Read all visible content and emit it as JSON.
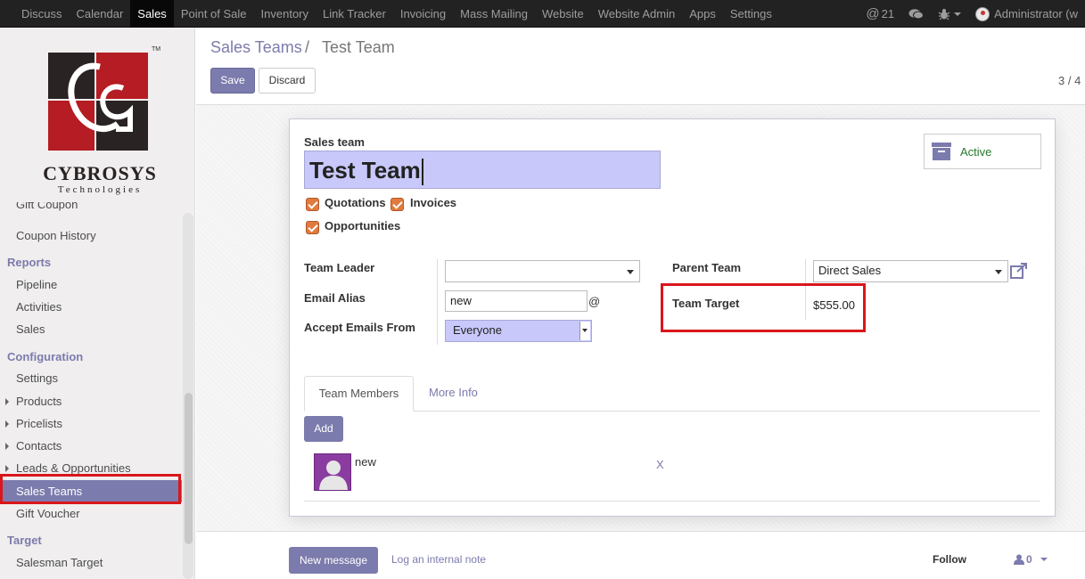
{
  "topbar": {
    "menu": [
      "Discuss",
      "Calendar",
      "Sales",
      "Point of Sale",
      "Inventory",
      "Link Tracker",
      "Invoicing",
      "Mass Mailing",
      "Website",
      "Website Admin",
      "Apps",
      "Settings"
    ],
    "active_menu": "Sales",
    "mentions_count": "21",
    "user_name": "Administrator (w"
  },
  "sidebar": {
    "logo": {
      "brand": "CYBROSYS",
      "tagline": "Technologies",
      "tm": "TM"
    },
    "items": {
      "gift_coupon": "Gift Coupon",
      "coupon_history": "Coupon History",
      "reports": "Reports",
      "pipeline": "Pipeline",
      "activities": "Activities",
      "sales": "Sales",
      "configuration": "Configuration",
      "settings": "Settings",
      "products": "Products",
      "pricelists": "Pricelists",
      "contacts": "Contacts",
      "leads": "Leads & Opportunities",
      "sales_teams": "Sales Teams",
      "gift_voucher": "Gift Voucher",
      "target": "Target",
      "salesman_target": "Salesman Target"
    }
  },
  "control": {
    "breadcrumb_root": "Sales Teams",
    "breadcrumb_sep": "/",
    "breadcrumb_current": "Test Team",
    "save_label": "Save",
    "discard_label": "Discard",
    "pager": "3 / 4"
  },
  "form": {
    "name_label": "Sales team",
    "name_value": "Test Team",
    "checkboxes": {
      "quotations": "Quotations",
      "invoices": "Invoices",
      "opportunities": "Opportunities"
    },
    "active_label": "Active",
    "team_leader_label": "Team Leader",
    "team_leader_value": "",
    "email_alias_label": "Email Alias",
    "email_alias_value": "new",
    "email_at": "@",
    "accept_emails_label": "Accept Emails From",
    "accept_emails_value": "Everyone",
    "parent_team_label": "Parent Team",
    "parent_team_value": "Direct Sales",
    "team_target_label": "Team Target",
    "team_target_value": "$555.00"
  },
  "tabs": {
    "members": "Team Members",
    "more_info": "More Info",
    "add_label": "Add",
    "member_name": "new",
    "remove_label": "X"
  },
  "chatter": {
    "new_message": "New message",
    "log_note": "Log an internal note",
    "follow": "Follow",
    "followers_count": "0"
  },
  "colors": {
    "accent": "#7c7bad",
    "highlight": "#d9161b",
    "checkbox": "#e07a3e",
    "active_green": "#26792b",
    "required_field": "#c8c8fa"
  }
}
